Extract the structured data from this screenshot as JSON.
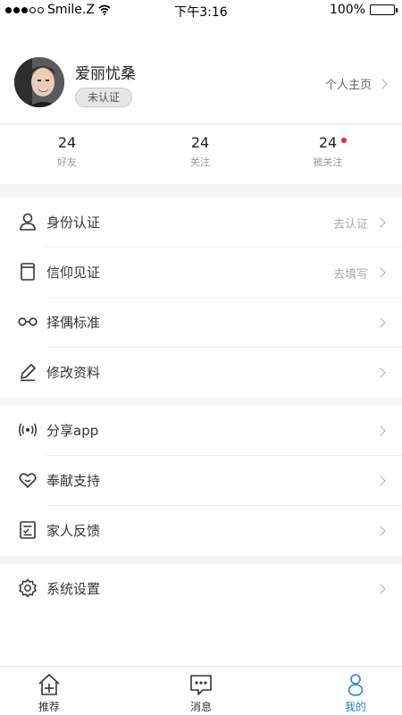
{
  "status_bar": {
    "carrier": "Smile.Z",
    "time": "下午3:16",
    "battery": "100%"
  },
  "profile": {
    "name": "爱丽忧桑",
    "verify_badge": "未认证",
    "homepage_link": "个人主页"
  },
  "stats": [
    {
      "count": "24",
      "label": "好友"
    },
    {
      "count": "24",
      "label": "关注"
    },
    {
      "count": "24",
      "label": "被关注"
    }
  ],
  "menu_group_1": [
    {
      "icon": "person-icon",
      "label": "身份认证",
      "hint": "去认证"
    },
    {
      "icon": "book-icon",
      "label": "信仰见证",
      "hint": "去填写"
    },
    {
      "icon": "glasses-icon",
      "label": "择偶标准",
      "hint": ""
    },
    {
      "icon": "pencil-icon",
      "label": "修改资料",
      "hint": ""
    }
  ],
  "menu_group_2": [
    {
      "icon": "broadcast-icon",
      "label": "分享app"
    },
    {
      "icon": "heart-icon",
      "label": "奉献支持"
    },
    {
      "icon": "feedback-icon",
      "label": "家人反馈"
    }
  ],
  "menu_group_3": [
    {
      "icon": "gear-icon",
      "label": "系统设置"
    }
  ],
  "tabbar": [
    {
      "icon": "home-plus-icon",
      "label": "推荐"
    },
    {
      "icon": "message-icon",
      "label": "消息"
    },
    {
      "icon": "user-icon",
      "label": "我的"
    }
  ],
  "colors": {
    "accent": "#2a7fd4",
    "notification_dot": "#e03030"
  }
}
